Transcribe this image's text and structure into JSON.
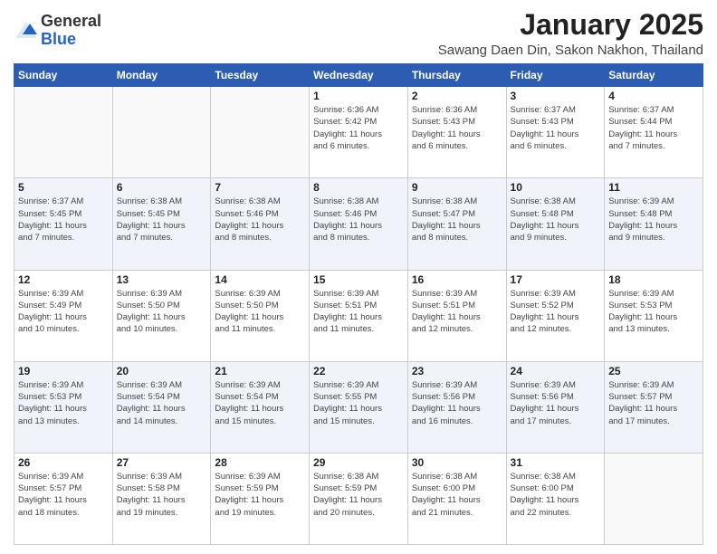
{
  "logo": {
    "general": "General",
    "blue": "Blue"
  },
  "title": "January 2025",
  "subtitle": "Sawang Daen Din, Sakon Nakhon, Thailand",
  "weekdays": [
    "Sunday",
    "Monday",
    "Tuesday",
    "Wednesday",
    "Thursday",
    "Friday",
    "Saturday"
  ],
  "weeks": [
    [
      {
        "day": "",
        "info": ""
      },
      {
        "day": "",
        "info": ""
      },
      {
        "day": "",
        "info": ""
      },
      {
        "day": "1",
        "info": "Sunrise: 6:36 AM\nSunset: 5:42 PM\nDaylight: 11 hours\nand 6 minutes."
      },
      {
        "day": "2",
        "info": "Sunrise: 6:36 AM\nSunset: 5:43 PM\nDaylight: 11 hours\nand 6 minutes."
      },
      {
        "day": "3",
        "info": "Sunrise: 6:37 AM\nSunset: 5:43 PM\nDaylight: 11 hours\nand 6 minutes."
      },
      {
        "day": "4",
        "info": "Sunrise: 6:37 AM\nSunset: 5:44 PM\nDaylight: 11 hours\nand 7 minutes."
      }
    ],
    [
      {
        "day": "5",
        "info": "Sunrise: 6:37 AM\nSunset: 5:45 PM\nDaylight: 11 hours\nand 7 minutes."
      },
      {
        "day": "6",
        "info": "Sunrise: 6:38 AM\nSunset: 5:45 PM\nDaylight: 11 hours\nand 7 minutes."
      },
      {
        "day": "7",
        "info": "Sunrise: 6:38 AM\nSunset: 5:46 PM\nDaylight: 11 hours\nand 8 minutes."
      },
      {
        "day": "8",
        "info": "Sunrise: 6:38 AM\nSunset: 5:46 PM\nDaylight: 11 hours\nand 8 minutes."
      },
      {
        "day": "9",
        "info": "Sunrise: 6:38 AM\nSunset: 5:47 PM\nDaylight: 11 hours\nand 8 minutes."
      },
      {
        "day": "10",
        "info": "Sunrise: 6:38 AM\nSunset: 5:48 PM\nDaylight: 11 hours\nand 9 minutes."
      },
      {
        "day": "11",
        "info": "Sunrise: 6:39 AM\nSunset: 5:48 PM\nDaylight: 11 hours\nand 9 minutes."
      }
    ],
    [
      {
        "day": "12",
        "info": "Sunrise: 6:39 AM\nSunset: 5:49 PM\nDaylight: 11 hours\nand 10 minutes."
      },
      {
        "day": "13",
        "info": "Sunrise: 6:39 AM\nSunset: 5:50 PM\nDaylight: 11 hours\nand 10 minutes."
      },
      {
        "day": "14",
        "info": "Sunrise: 6:39 AM\nSunset: 5:50 PM\nDaylight: 11 hours\nand 11 minutes."
      },
      {
        "day": "15",
        "info": "Sunrise: 6:39 AM\nSunset: 5:51 PM\nDaylight: 11 hours\nand 11 minutes."
      },
      {
        "day": "16",
        "info": "Sunrise: 6:39 AM\nSunset: 5:51 PM\nDaylight: 11 hours\nand 12 minutes."
      },
      {
        "day": "17",
        "info": "Sunrise: 6:39 AM\nSunset: 5:52 PM\nDaylight: 11 hours\nand 12 minutes."
      },
      {
        "day": "18",
        "info": "Sunrise: 6:39 AM\nSunset: 5:53 PM\nDaylight: 11 hours\nand 13 minutes."
      }
    ],
    [
      {
        "day": "19",
        "info": "Sunrise: 6:39 AM\nSunset: 5:53 PM\nDaylight: 11 hours\nand 13 minutes."
      },
      {
        "day": "20",
        "info": "Sunrise: 6:39 AM\nSunset: 5:54 PM\nDaylight: 11 hours\nand 14 minutes."
      },
      {
        "day": "21",
        "info": "Sunrise: 6:39 AM\nSunset: 5:54 PM\nDaylight: 11 hours\nand 15 minutes."
      },
      {
        "day": "22",
        "info": "Sunrise: 6:39 AM\nSunset: 5:55 PM\nDaylight: 11 hours\nand 15 minutes."
      },
      {
        "day": "23",
        "info": "Sunrise: 6:39 AM\nSunset: 5:56 PM\nDaylight: 11 hours\nand 16 minutes."
      },
      {
        "day": "24",
        "info": "Sunrise: 6:39 AM\nSunset: 5:56 PM\nDaylight: 11 hours\nand 17 minutes."
      },
      {
        "day": "25",
        "info": "Sunrise: 6:39 AM\nSunset: 5:57 PM\nDaylight: 11 hours\nand 17 minutes."
      }
    ],
    [
      {
        "day": "26",
        "info": "Sunrise: 6:39 AM\nSunset: 5:57 PM\nDaylight: 11 hours\nand 18 minutes."
      },
      {
        "day": "27",
        "info": "Sunrise: 6:39 AM\nSunset: 5:58 PM\nDaylight: 11 hours\nand 19 minutes."
      },
      {
        "day": "28",
        "info": "Sunrise: 6:39 AM\nSunset: 5:59 PM\nDaylight: 11 hours\nand 19 minutes."
      },
      {
        "day": "29",
        "info": "Sunrise: 6:38 AM\nSunset: 5:59 PM\nDaylight: 11 hours\nand 20 minutes."
      },
      {
        "day": "30",
        "info": "Sunrise: 6:38 AM\nSunset: 6:00 PM\nDaylight: 11 hours\nand 21 minutes."
      },
      {
        "day": "31",
        "info": "Sunrise: 6:38 AM\nSunset: 6:00 PM\nDaylight: 11 hours\nand 22 minutes."
      },
      {
        "day": "",
        "info": ""
      }
    ]
  ]
}
